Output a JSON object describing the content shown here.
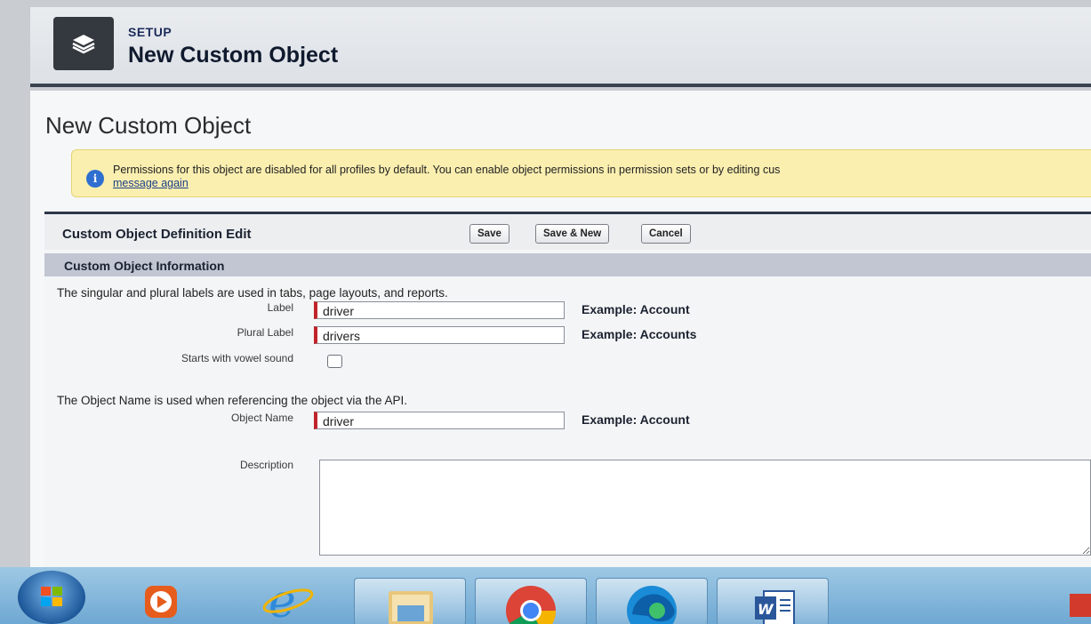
{
  "setup_header": {
    "label": "SETUP",
    "title": "New Custom Object",
    "icon": "layers-icon"
  },
  "page": {
    "title": "New Custom Object"
  },
  "alert": {
    "icon": "info-icon",
    "text": "Permissions for this object are disabled for all profiles by default. You can enable object permissions in permission sets or by editing cus",
    "link": "message again"
  },
  "edit": {
    "title": "Custom Object Definition Edit",
    "buttons": {
      "save": "Save",
      "save_new": "Save & New",
      "cancel": "Cancel"
    }
  },
  "section": {
    "title": "Custom Object Information",
    "labels_info": "The singular and plural labels are used in tabs, page layouts, and reports.",
    "api_info": "The Object Name is used when referencing the object via the API."
  },
  "fields": {
    "label": {
      "label": "Label",
      "value": "driver",
      "example": "Example: Account"
    },
    "plural_label": {
      "label": "Plural Label",
      "value": "drivers",
      "example": "Example: Accounts"
    },
    "vowel": {
      "label": "Starts with vowel sound",
      "checked": false
    },
    "object_name": {
      "label": "Object Name",
      "value": "driver",
      "example": "Example: Account"
    },
    "description": {
      "label": "Description",
      "value": ""
    }
  },
  "taskbar": {
    "items": [
      "start-orb",
      "media-player-icon",
      "internet-explorer-icon",
      "file-explorer-icon",
      "chrome-icon",
      "edge-icon",
      "word-icon"
    ]
  }
}
